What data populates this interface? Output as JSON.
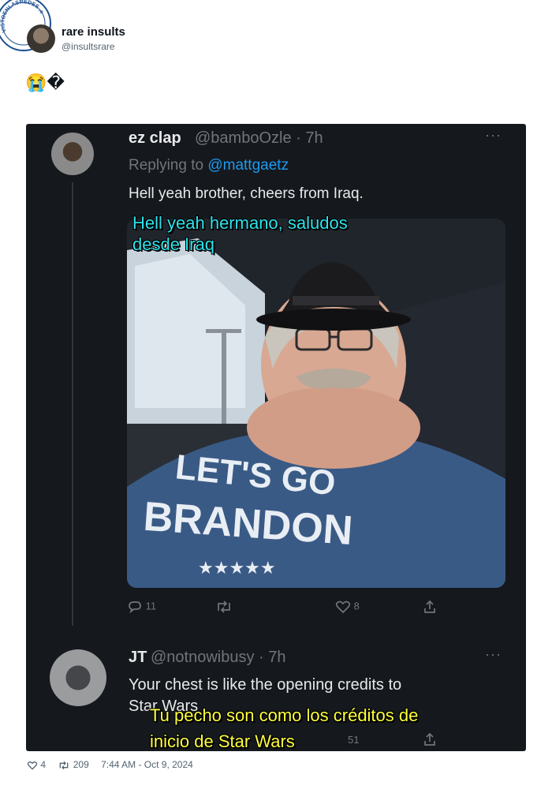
{
  "watermark": {
    "text": "VISTOENLASREDES .com"
  },
  "author": {
    "name": "rare insults",
    "handle": "@insultsrare"
  },
  "tweet": {
    "text": "😭�"
  },
  "embedded": {
    "tweet1": {
      "name": "ez clap",
      "handle": "@bamboOzle · 7h",
      "replying_prefix": "Replying to",
      "replying_to": "@mattgaetz",
      "text": "Hell yeah brother, cheers from Iraq.",
      "caption_line1": "Hell yeah hermano, saludos",
      "caption_line2": "desde Iraq",
      "shirt_line1": "LET'S GO",
      "shirt_line2": "BRANDON",
      "stats": {
        "replies": "11",
        "likes": "8"
      }
    },
    "tweet2": {
      "name": "JT",
      "handle": "@notnowibusy · 7h",
      "text_line1": "Your chest is like the opening credits to",
      "text_line2": "Star Wars",
      "caption_line1": "Tu pecho son como los créditos de",
      "caption_line2": "inicio de Star Wars",
      "stats": {
        "likes": "51"
      }
    }
  },
  "footer": {
    "likes": "4",
    "retweets": "209",
    "timestamp": "7:44 AM - Oct 9, 2024"
  },
  "colors": {
    "caption_cyan": "#2ee3ec",
    "caption_yellow": "#ffff3d",
    "link_blue": "#1d9bf0",
    "dark_bg": "#15181c"
  }
}
